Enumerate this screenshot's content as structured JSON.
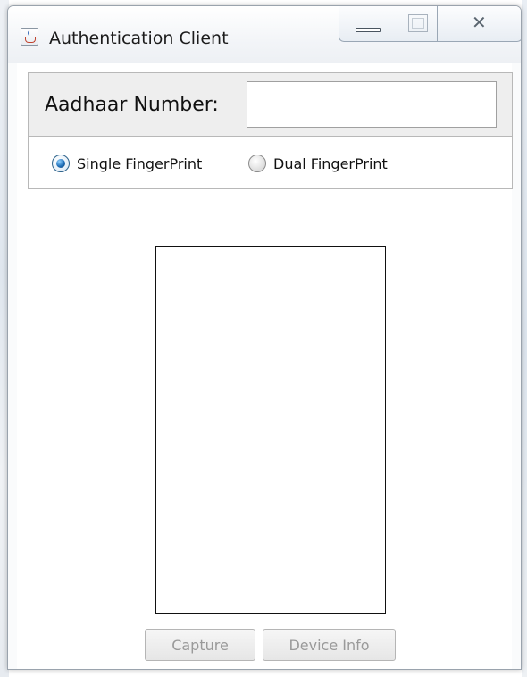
{
  "window": {
    "title": "Authentication Client",
    "icons": {
      "app": "java-cup-icon",
      "minimize": "minimize-icon",
      "maximize": "maximize-icon",
      "close": "close-icon"
    },
    "close_glyph": "✕"
  },
  "aadhaar": {
    "label": "Aadhaar Number:",
    "value": ""
  },
  "mode": {
    "options": [
      {
        "label": "Single FingerPrint",
        "selected": true
      },
      {
        "label": "Dual FingerPrint",
        "selected": false
      }
    ]
  },
  "buttons": {
    "capture_label": "Capture",
    "device_info_label": "Device Info",
    "enabled": false
  }
}
